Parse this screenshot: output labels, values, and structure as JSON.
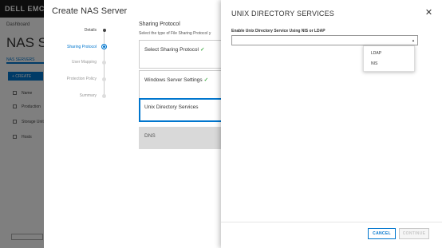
{
  "background": {
    "logo": "DELL EMC",
    "breadcrumb": "Dashboard",
    "page_title": "NAS Ser",
    "tab_label": "NAS SERVERS",
    "create_label": "+ CREATE",
    "rows": [
      "Name",
      "Production",
      "Storage Unit",
      "Hosts"
    ]
  },
  "wizard": {
    "title": "Create NAS Server",
    "steps": [
      {
        "label": "Details",
        "state": "done"
      },
      {
        "label": "Sharing Protocol",
        "state": "active"
      },
      {
        "label": "User Mapping",
        "state": "pending"
      },
      {
        "label": "Protection Policy",
        "state": "pending"
      },
      {
        "label": "Summary",
        "state": "pending"
      }
    ],
    "section_title": "Sharing Protocol",
    "section_desc": "Select the type of File Sharing Protocol y",
    "cards": [
      {
        "label": "Select Sharing Protocol",
        "check": "✓"
      },
      {
        "label": "Windows Server Settings",
        "check": "✓"
      },
      {
        "label": "Unix Directory Services",
        "check": ""
      },
      {
        "label": "DNS",
        "check": ""
      }
    ]
  },
  "panel": {
    "title": "UNIX DIRECTORY SERVICES",
    "close": "✕",
    "field_label": "Enable Unix Directory Service Using NIS or LDAP",
    "select_value": "",
    "caret": "▲",
    "options": [
      "LDAP",
      "NIS"
    ],
    "cancel_label": "CANCEL",
    "continue_label": "CONTINUE"
  },
  "colors": {
    "accent": "#0076ce",
    "check": "#4caf50",
    "disabled_card": "#d9d9d9"
  }
}
